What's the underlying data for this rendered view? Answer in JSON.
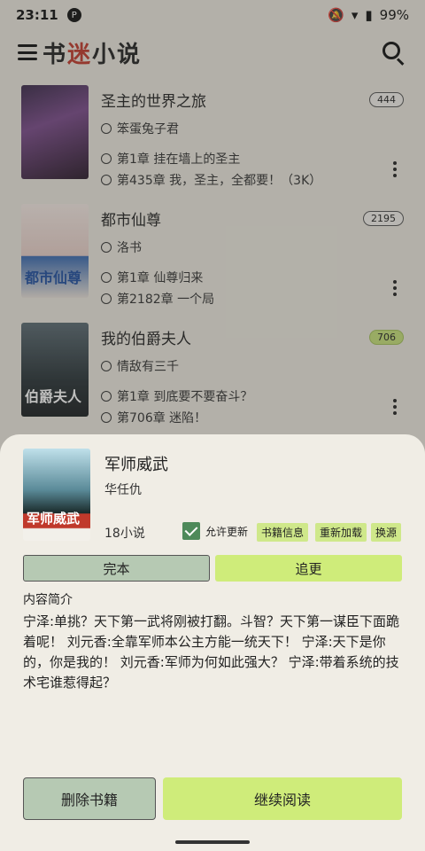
{
  "status_bar": {
    "time": "23:11",
    "battery": "99%"
  },
  "app_bar": {
    "title_part1": "书",
    "title_accent": "迷",
    "title_part2": "小说"
  },
  "books": [
    {
      "title": "圣主的世界之旅",
      "author": "笨蛋兔子君",
      "last_read": "第1章 挂在墙上的圣主",
      "latest": "第435章 我，圣主，全都要！（3K）",
      "badge": "444",
      "badge_color": "outline"
    },
    {
      "title": "都市仙尊",
      "author": "洛书",
      "last_read": "第1章 仙尊归来",
      "latest": "第2182章 一个局",
      "badge": "2195",
      "badge_color": "outline",
      "cover_text": "都市仙尊"
    },
    {
      "title": "我的伯爵夫人",
      "author": "情敌有三千",
      "last_read": "第1章 到底要不要奋斗？",
      "latest": "第706章 迷陷！",
      "badge": "706",
      "badge_color": "#c6e07a",
      "cover_text": "伯爵夫人"
    }
  ],
  "sheet": {
    "title": "军师威武",
    "author": "华任仇",
    "source": "18小说",
    "cover_text": "军师威武",
    "allow_update_label": "允许更新",
    "allow_update_checked": true,
    "chip_info": "书籍信息",
    "chip_reload": "重新加载",
    "chip_source": "换源",
    "btn_finished": "完本",
    "btn_follow": "追更",
    "intro_title": "内容简介",
    "intro_text": "宁泽:单挑？天下第一武将刚被打翻。斗智？天下第一谋臣下面跪着呢！ 刘元香:全靠军师本公主方能一统天下！ 宁泽:天下是你的，你是我的！ 刘元香:军师为何如此强大？ 宁泽:带着系统的技术宅谁惹得起？",
    "btn_remove": "删除书籍",
    "btn_continue": "继续阅读"
  },
  "colors": {
    "accent_green": "#cfec7a",
    "muted_green": "#b6c9b3",
    "checkbox_green": "#4e8a5a",
    "title_accent_red": "#c0392b"
  }
}
